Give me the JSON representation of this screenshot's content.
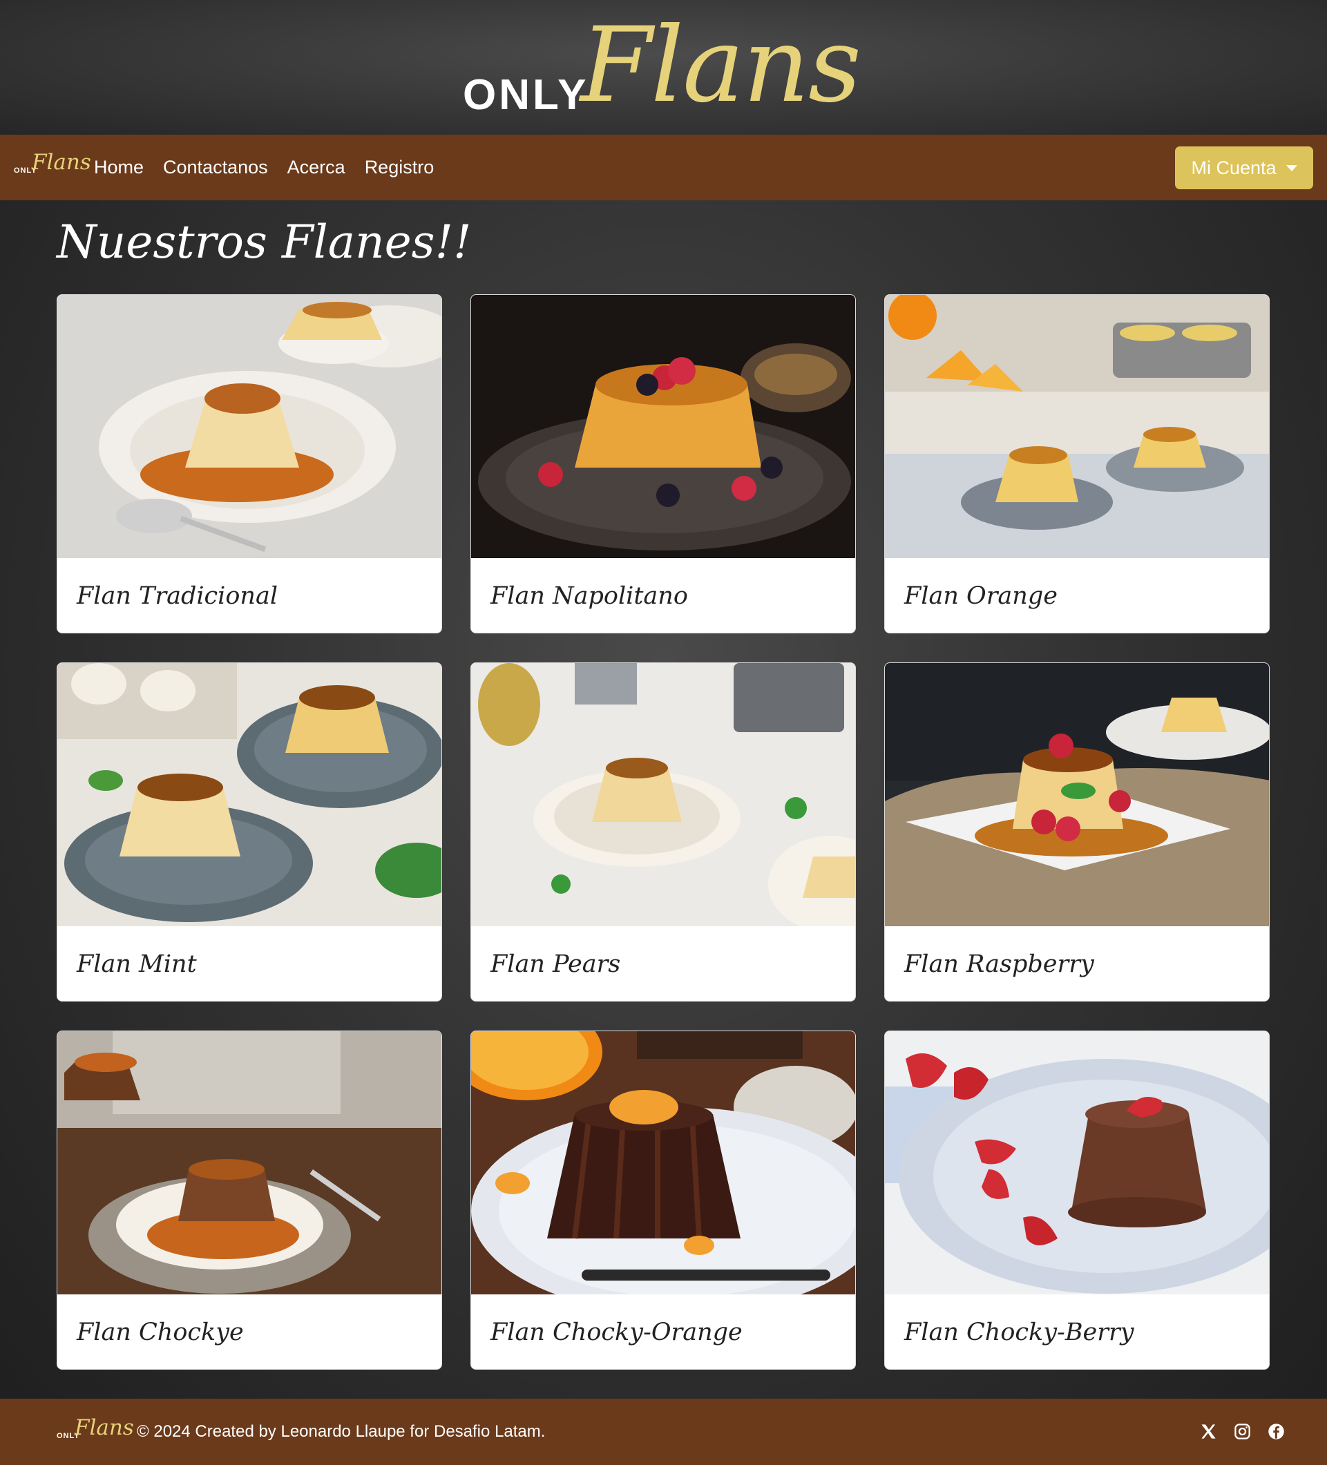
{
  "header": {
    "logo_only": "ONLY",
    "logo_flans": "Flans"
  },
  "navbar": {
    "brand_only": "ONLY",
    "brand_flans": "Flans",
    "links": [
      "Home",
      "Contactanos",
      "Acerca",
      "Registro"
    ],
    "account_label": "Mi Cuenta"
  },
  "main": {
    "title": "Nuestros Flanes!!",
    "cards": [
      {
        "title": "Flan Tradicional"
      },
      {
        "title": "Flan Napolitano"
      },
      {
        "title": "Flan Orange"
      },
      {
        "title": "Flan Mint"
      },
      {
        "title": "Flan Pears"
      },
      {
        "title": "Flan Raspberry"
      },
      {
        "title": "Flan Chockye"
      },
      {
        "title": "Flan Chocky-Orange"
      },
      {
        "title": "Flan Chocky-Berry"
      }
    ]
  },
  "footer": {
    "brand_only": "ONLY",
    "brand_flans": "Flans",
    "text": "© 2024 Created by Leonardo Llaupe for Desafio Latam.",
    "social_icons": [
      "x-icon",
      "instagram-icon",
      "facebook-icon"
    ]
  },
  "colors": {
    "navbar": "#6b3a1a",
    "accent_gold": "#dcc35b",
    "logo_gold": "#e6d27a"
  }
}
